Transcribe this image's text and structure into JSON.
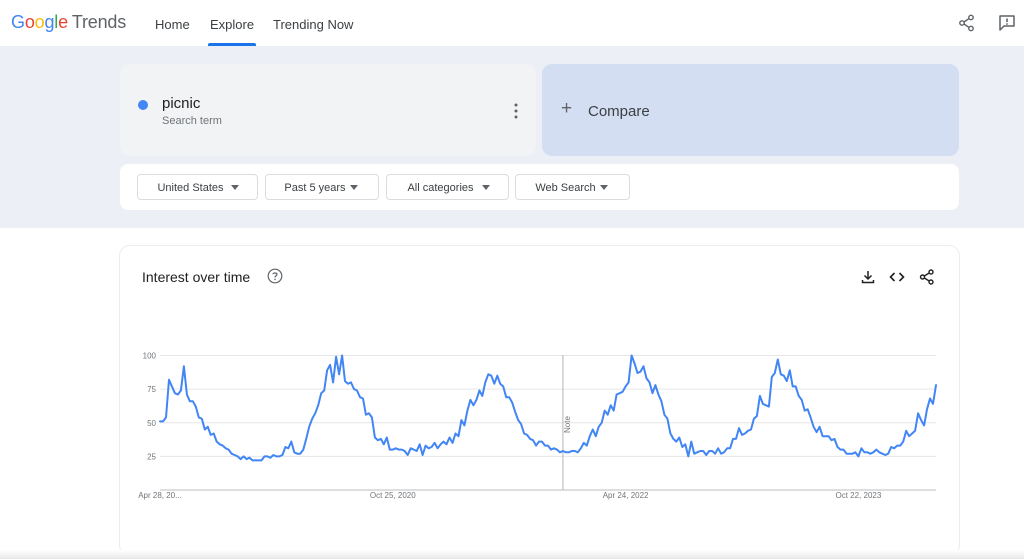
{
  "header": {
    "logo": {
      "google": "Google",
      "trends": "Trends"
    },
    "tabs": [
      {
        "label": "Home"
      },
      {
        "label": "Explore",
        "active": true
      },
      {
        "label": "Trending Now"
      }
    ],
    "icons": [
      "share-icon",
      "feedback-icon"
    ]
  },
  "search": {
    "term": {
      "name": "picnic",
      "type": "Search term",
      "color": "#4285f4"
    },
    "compare_label": "Compare",
    "filters": [
      {
        "label": "United States"
      },
      {
        "label": "Past 5 years"
      },
      {
        "label": "All categories"
      },
      {
        "label": "Web Search"
      }
    ]
  },
  "interest_card": {
    "title": "Interest over time",
    "icons": [
      "help-icon",
      "download-icon",
      "embed-icon",
      "share-icon"
    ],
    "note_label": "Note"
  },
  "chart_data": {
    "type": "line",
    "title": "Interest over time",
    "series": [
      {
        "color": "#4285f4",
        "x": [
          "2019-04-28",
          "2019-05-05",
          "2019-05-12",
          "2019-05-19",
          "2019-05-26",
          "2019-06-02",
          "2019-06-09",
          "2019-06-16",
          "2019-06-23",
          "2019-06-30",
          "2019-07-07",
          "2019-07-14",
          "2019-07-21",
          "2019-07-28",
          "2019-08-04",
          "2019-08-11",
          "2019-08-18",
          "2019-08-25",
          "2019-09-01",
          "2019-09-08",
          "2019-09-15",
          "2019-09-22",
          "2019-09-29",
          "2019-10-06",
          "2019-10-13",
          "2019-10-20",
          "2019-10-27",
          "2019-11-03",
          "2019-11-10",
          "2019-11-17",
          "2019-11-24",
          "2019-12-01",
          "2019-12-08",
          "2019-12-15",
          "2019-12-22",
          "2019-12-29",
          "2020-01-05",
          "2020-01-12",
          "2020-01-19",
          "2020-01-26",
          "2020-02-02",
          "2020-02-09",
          "2020-02-16",
          "2020-02-23",
          "2020-03-01",
          "2020-03-08",
          "2020-03-15",
          "2020-03-22",
          "2020-03-29",
          "2020-04-05",
          "2020-04-12",
          "2020-04-19",
          "2020-04-26",
          "2020-05-03",
          "2020-05-10",
          "2020-05-17",
          "2020-05-24",
          "2020-05-31",
          "2020-06-07",
          "2020-06-14",
          "2020-06-21",
          "2020-06-28",
          "2020-07-05",
          "2020-07-12",
          "2020-07-19",
          "2020-07-26",
          "2020-08-02",
          "2020-08-09",
          "2020-08-16",
          "2020-08-23",
          "2020-08-30",
          "2020-09-06",
          "2020-09-13",
          "2020-09-20",
          "2020-09-27",
          "2020-10-04",
          "2020-10-11",
          "2020-10-18",
          "2020-10-25",
          "2020-11-01",
          "2020-11-08",
          "2020-11-15",
          "2020-11-22",
          "2020-11-29",
          "2020-12-06",
          "2020-12-13",
          "2020-12-20",
          "2020-12-27",
          "2021-01-03",
          "2021-01-10",
          "2021-01-17",
          "2021-01-24",
          "2021-01-31",
          "2021-02-07",
          "2021-02-14",
          "2021-02-21",
          "2021-02-28",
          "2021-03-07",
          "2021-03-14",
          "2021-03-21",
          "2021-03-28",
          "2021-04-04",
          "2021-04-11",
          "2021-04-18",
          "2021-04-25",
          "2021-05-02",
          "2021-05-09",
          "2021-05-16",
          "2021-05-23",
          "2021-05-30",
          "2021-06-06",
          "2021-06-13",
          "2021-06-20",
          "2021-06-27",
          "2021-07-04",
          "2021-07-11",
          "2021-07-18",
          "2021-07-25",
          "2021-08-01",
          "2021-08-08",
          "2021-08-15",
          "2021-08-22",
          "2021-08-29",
          "2021-09-05",
          "2021-09-12",
          "2021-09-19",
          "2021-09-26",
          "2021-10-03",
          "2021-10-10",
          "2021-10-17",
          "2021-10-24",
          "2021-10-31",
          "2021-11-07",
          "2021-11-14",
          "2021-11-21",
          "2021-11-28",
          "2021-12-05",
          "2021-12-12",
          "2021-12-19",
          "2021-12-26",
          "2022-01-02",
          "2022-01-09",
          "2022-01-16",
          "2022-01-23",
          "2022-01-30",
          "2022-02-06",
          "2022-02-13",
          "2022-02-20",
          "2022-02-27",
          "2022-03-06",
          "2022-03-13",
          "2022-03-20",
          "2022-03-27",
          "2022-04-03",
          "2022-04-10",
          "2022-04-17",
          "2022-04-24",
          "2022-05-01",
          "2022-05-08",
          "2022-05-15",
          "2022-05-22",
          "2022-05-29",
          "2022-06-05",
          "2022-06-12",
          "2022-06-19",
          "2022-06-26",
          "2022-07-03",
          "2022-07-10",
          "2022-07-17",
          "2022-07-24",
          "2022-07-31",
          "2022-08-07",
          "2022-08-14",
          "2022-08-21",
          "2022-08-28",
          "2022-09-04",
          "2022-09-11",
          "2022-09-18",
          "2022-09-25",
          "2022-10-02",
          "2022-10-09",
          "2022-10-16",
          "2022-10-23",
          "2022-10-30",
          "2022-11-06",
          "2022-11-13",
          "2022-11-20",
          "2022-11-27",
          "2022-12-04",
          "2022-12-11",
          "2022-12-18",
          "2022-12-25",
          "2023-01-01",
          "2023-01-08",
          "2023-01-15",
          "2023-01-22",
          "2023-01-29",
          "2023-02-05",
          "2023-02-12",
          "2023-02-19",
          "2023-02-26",
          "2023-03-05",
          "2023-03-12",
          "2023-03-19",
          "2023-03-26",
          "2023-04-02",
          "2023-04-09",
          "2023-04-16",
          "2023-04-23",
          "2023-04-30",
          "2023-05-07",
          "2023-05-14",
          "2023-05-21",
          "2023-05-28",
          "2023-06-04",
          "2023-06-11",
          "2023-06-18",
          "2023-06-25",
          "2023-07-02",
          "2023-07-09",
          "2023-07-16",
          "2023-07-23",
          "2023-07-30",
          "2023-08-06",
          "2023-08-13",
          "2023-08-20",
          "2023-08-27",
          "2023-09-03",
          "2023-09-10",
          "2023-09-17",
          "2023-09-24",
          "2023-10-01",
          "2023-10-08",
          "2023-10-15",
          "2023-10-22",
          "2023-10-29",
          "2023-11-05",
          "2023-11-12",
          "2023-11-19",
          "2023-11-26",
          "2023-12-03",
          "2023-12-10",
          "2023-12-17",
          "2023-12-24",
          "2023-12-31",
          "2024-01-07",
          "2024-01-14",
          "2024-01-21",
          "2024-01-28",
          "2024-02-04",
          "2024-02-11",
          "2024-02-18",
          "2024-02-25",
          "2024-03-03",
          "2024-03-10",
          "2024-03-17",
          "2024-03-24",
          "2024-03-31",
          "2024-04-07",
          "2024-04-14",
          "2024-04-21"
        ],
        "values": [
          51,
          51,
          54,
          82,
          77,
          72,
          71,
          74,
          92,
          71,
          66,
          66,
          62,
          54,
          53,
          45,
          47,
          41,
          42,
          36,
          34,
          33,
          31,
          30,
          27,
          26,
          25,
          23,
          25,
          23,
          24,
          22,
          22,
          22,
          22,
          25,
          25,
          24,
          26,
          25,
          25,
          26,
          32,
          31,
          36,
          28,
          27,
          27,
          30,
          38,
          47,
          53,
          57,
          63,
          72,
          74,
          89,
          93,
          80,
          99,
          86,
          100,
          81,
          79,
          80,
          75,
          74,
          69,
          68,
          56,
          57,
          54,
          39,
          37,
          38,
          34,
          39,
          30,
          30,
          31,
          30,
          30,
          29,
          26,
          31,
          30,
          29,
          34,
          26,
          33,
          31,
          32,
          35,
          31,
          34,
          36,
          34,
          39,
          35,
          42,
          40,
          52,
          48,
          59,
          67,
          63,
          67,
          74,
          70,
          80,
          86,
          85,
          79,
          85,
          79,
          77,
          69,
          69,
          65,
          58,
          52,
          49,
          42,
          41,
          38,
          37,
          33,
          36,
          36,
          33,
          33,
          30,
          31,
          30,
          28,
          29,
          28,
          28,
          29,
          29,
          28,
          31,
          35,
          33,
          40,
          45,
          40,
          47,
          50,
          59,
          56,
          63,
          59,
          71,
          72,
          73,
          77,
          80,
          100,
          94,
          87,
          88,
          92,
          83,
          80,
          72,
          78,
          71,
          66,
          56,
          53,
          42,
          38,
          36,
          39,
          32,
          34,
          25,
          36,
          27,
          28,
          29,
          29,
          26,
          29,
          29,
          27,
          31,
          27,
          28,
          31,
          31,
          38,
          38,
          46,
          41,
          42,
          44,
          45,
          53,
          55,
          70,
          64,
          63,
          62,
          84,
          87,
          97,
          86,
          85,
          81,
          89,
          77,
          77,
          70,
          67,
          59,
          60,
          54,
          47,
          43,
          47,
          40,
          40,
          40,
          37,
          38,
          32,
          30,
          30,
          27,
          27,
          27,
          28,
          25,
          31,
          28,
          28,
          27,
          28,
          30,
          28,
          27,
          26,
          27,
          32,
          31,
          33,
          33,
          36,
          44,
          40,
          42,
          44,
          57,
          52,
          48,
          60,
          68,
          64,
          78
        ]
      }
    ],
    "y_ticks": [
      25,
      50,
      75,
      100
    ],
    "ylim": [
      0,
      100
    ],
    "x_tick_labels": [
      "Apr 28, 20...",
      "Oct 25, 2020",
      "Apr 24, 2022",
      "Oct 22, 2023"
    ],
    "grid": true,
    "annotations": [
      "Note"
    ]
  }
}
